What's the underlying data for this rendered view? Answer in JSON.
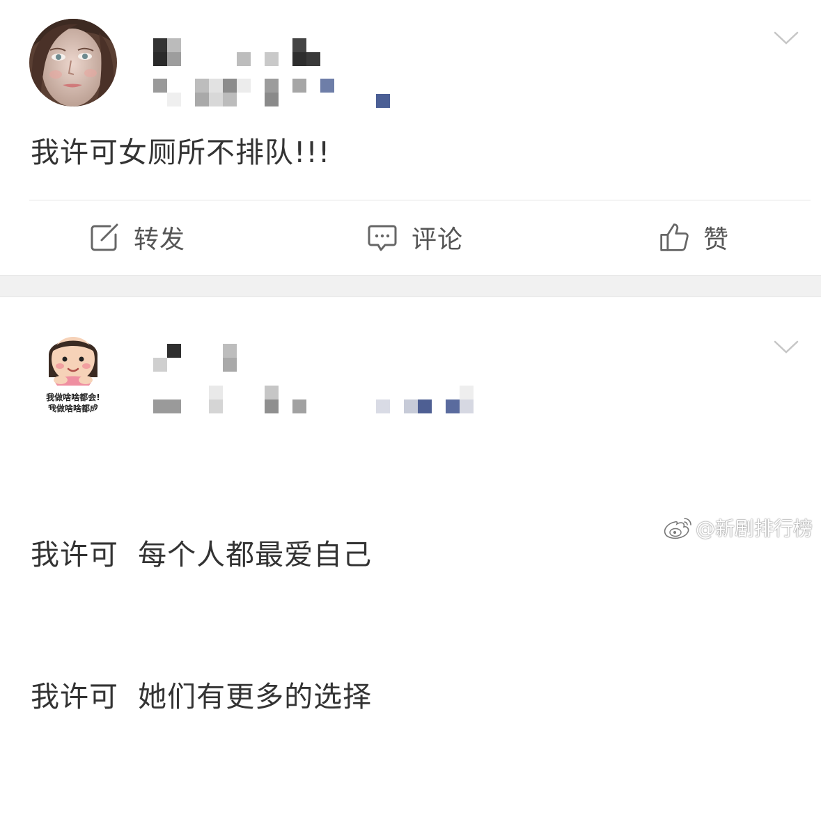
{
  "posts": [
    {
      "avatar_icon": "woman-photo-avatar",
      "content": "我许可女厕所不排队!!!",
      "actions": {
        "repost": "转发",
        "comment": "评论",
        "like": "赞"
      }
    },
    {
      "avatar_icon": "cartoon-girl-avatar",
      "avatar_caption_1": "我做啥啥都会!",
      "avatar_caption_2": "我做啥啥都成",
      "content_line_1": "我许可  每个人都最爱自己",
      "content_line_2": "我许可  她们有更多的选择"
    }
  ],
  "watermark": {
    "text": "@新剧排行榜",
    "icon": "weibo-logo-icon"
  },
  "colors": {
    "accent_blue": "#6a7ba3",
    "divider": "#e5e5e5",
    "gap": "#f1f1f1"
  }
}
